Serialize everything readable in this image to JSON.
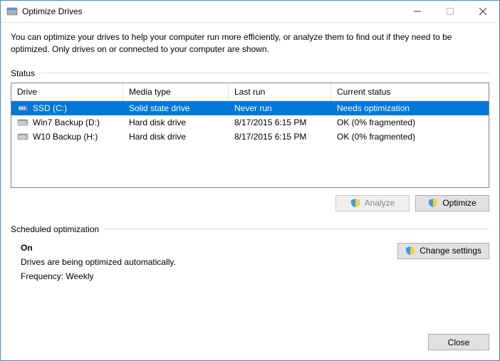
{
  "window": {
    "title": "Optimize Drives"
  },
  "intro": "You can optimize your drives to help your computer run more efficiently, or analyze them to find out if they need to be optimized. Only drives on or connected to your computer are shown.",
  "status_label": "Status",
  "table": {
    "headers": {
      "drive": "Drive",
      "media": "Media type",
      "last": "Last run",
      "status": "Current status"
    },
    "rows": [
      {
        "icon": "ssd",
        "drive": "SSD (C:)",
        "media": "Solid state drive",
        "last": "Never run",
        "status": "Needs optimization",
        "selected": true
      },
      {
        "icon": "hdd",
        "drive": "Win7 Backup (D:)",
        "media": "Hard disk drive",
        "last": "8/17/2015 6:15 PM",
        "status": "OK (0% fragmented)",
        "selected": false
      },
      {
        "icon": "hdd",
        "drive": "W10 Backup (H:)",
        "media": "Hard disk drive",
        "last": "8/17/2015 6:15 PM",
        "status": "OK (0% fragmented)",
        "selected": false
      }
    ]
  },
  "buttons": {
    "analyze": "Analyze",
    "optimize": "Optimize",
    "change_settings": "Change settings",
    "close": "Close"
  },
  "scheduled": {
    "label": "Scheduled optimization",
    "state": "On",
    "description": "Drives are being optimized automatically.",
    "frequency": "Frequency: Weekly"
  }
}
